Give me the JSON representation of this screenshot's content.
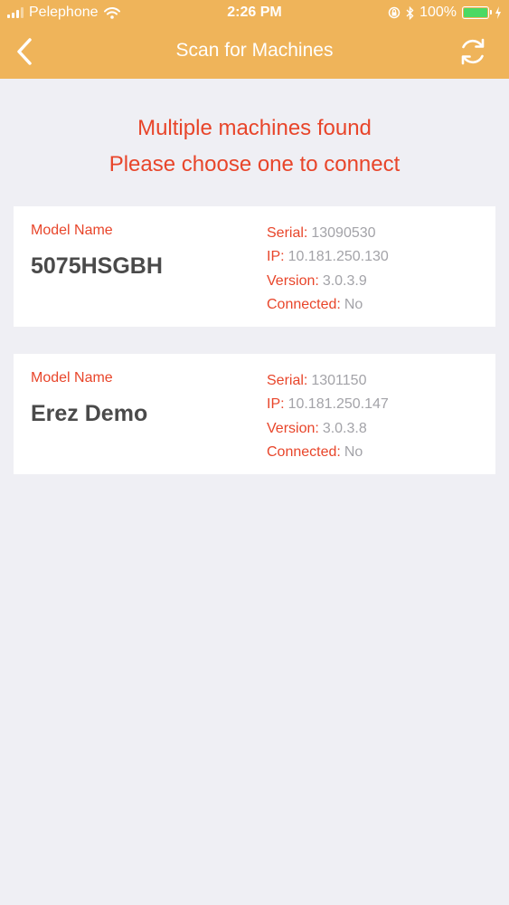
{
  "status_bar": {
    "carrier": "Pelephone",
    "time": "2:26 PM",
    "battery": "100%",
    "battery_level": 1.0,
    "icons": [
      "signal-icon",
      "wifi-icon",
      "rotation-lock-icon",
      "bluetooth-icon",
      "battery-icon",
      "charging-icon"
    ]
  },
  "nav": {
    "title": "Scan for Machines",
    "back_icon": "chevron-left-icon",
    "refresh_icon": "refresh-icon"
  },
  "message": {
    "line1": "Multiple machines found",
    "line2": "Please choose one to connect"
  },
  "machines": [
    {
      "label": "Model Name",
      "name": "5075HSGBH",
      "serial_label": "Serial:",
      "serial": "13090530",
      "ip_label": "IP:",
      "ip": "10.181.250.130",
      "version_label": "Version:",
      "version": "3.0.3.9",
      "connected_label": "Connected:",
      "connected": "No"
    },
    {
      "label": "Model Name",
      "name": "Erez Demo",
      "serial_label": "Serial:",
      "serial": "1301150",
      "ip_label": "IP:",
      "ip": "10.181.250.147",
      "version_label": "Version:",
      "version": "3.0.3.8",
      "connected_label": "Connected:",
      "connected": "No"
    }
  ],
  "colors": {
    "header": "#efb45a",
    "accent": "#e8452a",
    "background": "#efeff4",
    "value_gray": "#a3a3a8",
    "name_text": "#4a4a4a",
    "battery_green": "#4cd964"
  }
}
